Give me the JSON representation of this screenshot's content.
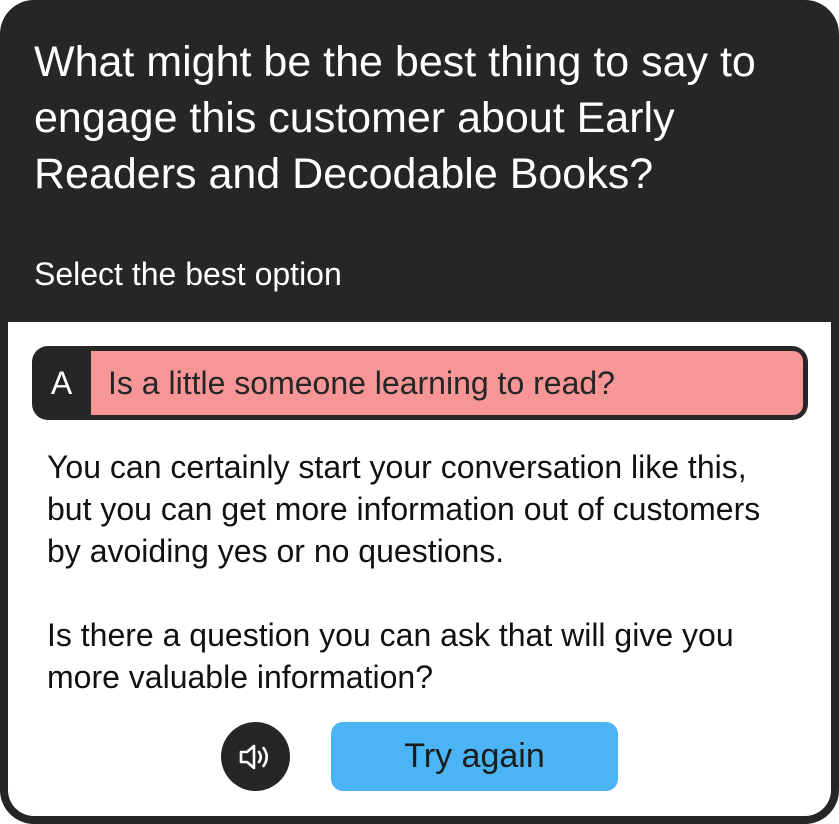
{
  "question": {
    "text": "What might be the best thing to say to engage this customer about Early Readers and Decodable Books?"
  },
  "instruction": "Select the best option",
  "option": {
    "letter": "A",
    "text": "Is a little someone learning to read?",
    "state_color": "#f69696"
  },
  "feedback": {
    "paragraph1": "You can certainly start your conversation like this, but you can get more information out of customers by avoiding yes or no questions.",
    "paragraph2": "Is there a question you can ask that will give you more valuable information?"
  },
  "controls": {
    "audio_icon": "speaker-icon",
    "try_again_label": "Try again"
  },
  "colors": {
    "card_background": "#262626",
    "panel_background": "#ffffff",
    "wrong_answer": "#f69696",
    "primary_button": "#4ab4f4"
  }
}
